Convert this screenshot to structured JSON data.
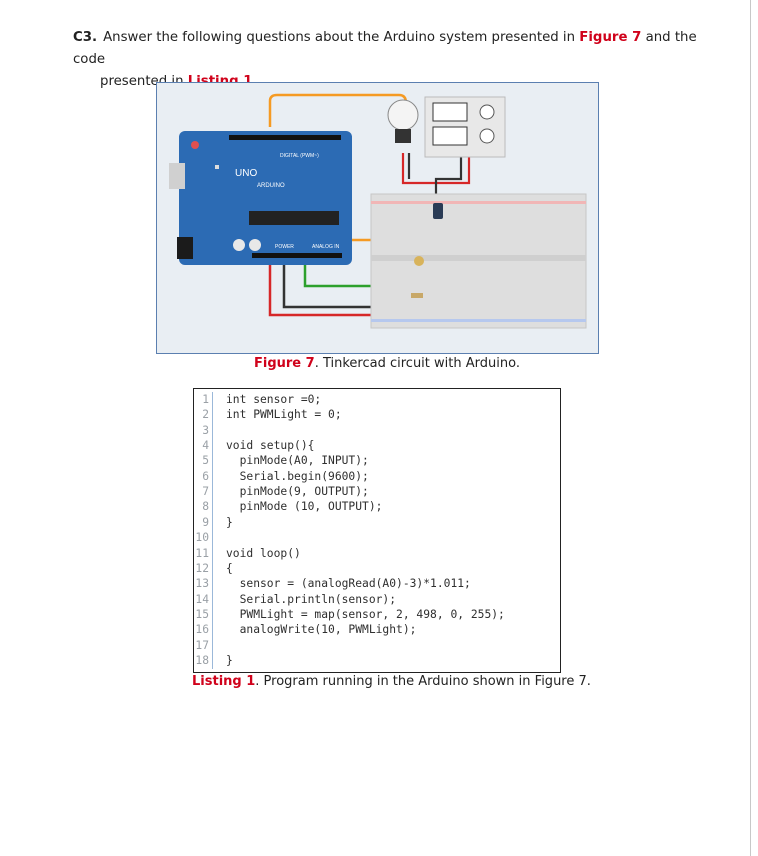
{
  "question": {
    "number": "C3.",
    "line1_a": "Answer the following questions about the Arduino system presented in ",
    "line1_fig": "Figure 7",
    "line1_b": " and the code",
    "line2_a": "presented in ",
    "line2_listing": "Listing 1",
    "line2_b": "."
  },
  "figure": {
    "board_logo": "UNO",
    "board_brand": "ARDUINO",
    "board_digital": "DIGITAL (PWM~)",
    "board_power": "POWER",
    "board_analog": "ANALOG IN",
    "caption_label": "Figure 7",
    "caption_text": ". Tinkercad circuit with Arduino."
  },
  "listing": {
    "lines": [
      {
        "n": "1",
        "code": "int sensor =0;"
      },
      {
        "n": "2",
        "code": "int PWMLight = 0;"
      },
      {
        "n": "3",
        "code": ""
      },
      {
        "n": "4",
        "code": "void setup(){"
      },
      {
        "n": "5",
        "code": "  pinMode(A0, INPUT);"
      },
      {
        "n": "6",
        "code": "  Serial.begin(9600);"
      },
      {
        "n": "7",
        "code": "  pinMode(9, OUTPUT);"
      },
      {
        "n": "8",
        "code": "  pinMode (10, OUTPUT);"
      },
      {
        "n": "9",
        "code": "}"
      },
      {
        "n": "10",
        "code": ""
      },
      {
        "n": "11",
        "code": "void loop()"
      },
      {
        "n": "12",
        "code": "{"
      },
      {
        "n": "13",
        "code": "  sensor = (analogRead(A0)-3)*1.011;"
      },
      {
        "n": "14",
        "code": "  Serial.println(sensor);"
      },
      {
        "n": "15",
        "code": "  PWMLight = map(sensor, 2, 498, 0, 255);"
      },
      {
        "n": "16",
        "code": "  analogWrite(10, PWMLight);"
      },
      {
        "n": "17",
        "code": ""
      },
      {
        "n": "18",
        "code": "}"
      }
    ],
    "caption_label": "Listing 1",
    "caption_text": ". Program running in the Arduino shown in Figure 7."
  }
}
